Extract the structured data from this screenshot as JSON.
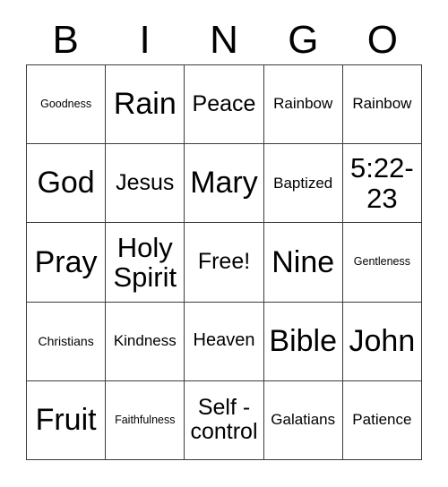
{
  "card": {
    "header": {
      "letters": [
        "B",
        "I",
        "N",
        "G",
        "O"
      ]
    },
    "grid": {
      "rows": 5,
      "columns": 5,
      "border_color": "#3b3b3b",
      "background_color": "#ffffff",
      "text_color": "#000000",
      "cells": [
        [
          {
            "label": "Goodness",
            "size": "tiny"
          },
          {
            "label": "Rain",
            "size": "xl"
          },
          {
            "label": "Peace",
            "size": "md"
          },
          {
            "label": "Rainbow",
            "size": "xs"
          },
          {
            "label": "Rainbow",
            "size": "xs"
          }
        ],
        [
          {
            "label": "God",
            "size": "xl"
          },
          {
            "label": "Jesus",
            "size": "md"
          },
          {
            "label": "Mary",
            "size": "xl"
          },
          {
            "label": "Baptized",
            "size": "xs"
          },
          {
            "label": "5:22-23",
            "size": "lg"
          }
        ],
        [
          {
            "label": "Pray",
            "size": "xl"
          },
          {
            "label": "Holy Spirit",
            "size": "lg"
          },
          {
            "label": "Free!",
            "size": "md"
          },
          {
            "label": "Nine",
            "size": "xl"
          },
          {
            "label": "Gentleness",
            "size": "tiny"
          }
        ],
        [
          {
            "label": "Christians",
            "size": "xxs"
          },
          {
            "label": "Kindness",
            "size": "xs"
          },
          {
            "label": "Heaven",
            "size": "sm"
          },
          {
            "label": "Bible",
            "size": "xl"
          },
          {
            "label": "John",
            "size": "xl"
          }
        ],
        [
          {
            "label": "Fruit",
            "size": "xl"
          },
          {
            "label": "Faithfulness",
            "size": "tiny"
          },
          {
            "label": "Self - control",
            "size": "md"
          },
          {
            "label": "Galatians",
            "size": "xs"
          },
          {
            "label": "Patience",
            "size": "xs"
          }
        ]
      ]
    }
  }
}
